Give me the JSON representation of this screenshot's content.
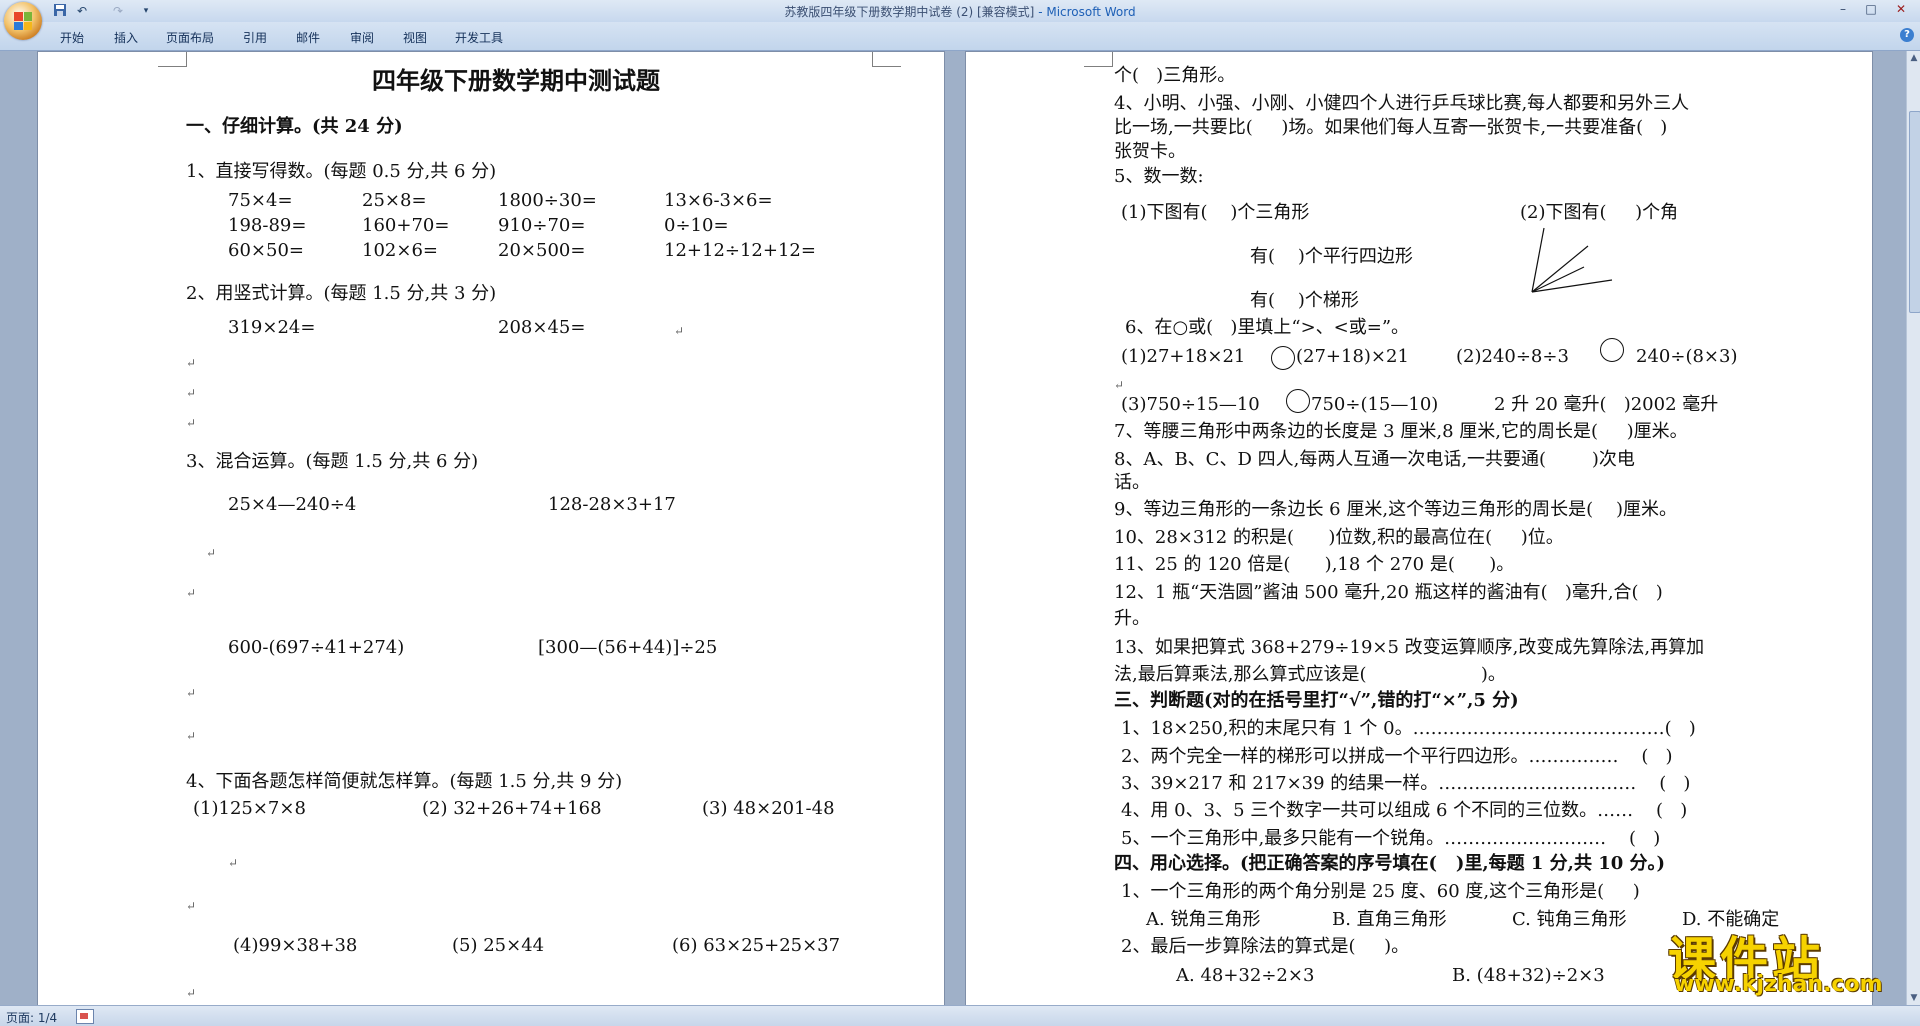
{
  "window": {
    "title": "苏教版四年级下册数学期中试卷 (2) [兼容模式]",
    "app": " - Microsoft Word",
    "minimize": "–",
    "maximize": "□",
    "close": "✕"
  },
  "quick_access": {
    "undo": "↶",
    "redo": "↷",
    "customize": "▾"
  },
  "ribbon_tabs": [
    "开始",
    "插入",
    "页面布局",
    "引用",
    "邮件",
    "审阅",
    "视图",
    "开发工具"
  ],
  "help": "?",
  "page1": {
    "title": "四年级下册数学期中测试题",
    "section1": "一、仔细计算。(共 24 分)",
    "q1": "1、直接写得数。(每题 0.5 分,共 6 分)",
    "q1_rows": [
      [
        "75×4=",
        "25×8=",
        "1800÷30=",
        "13×6-3×6="
      ],
      [
        "198-89=",
        "160+70=",
        "910÷70=",
        "0÷10="
      ],
      [
        "60×50=",
        "102×6=",
        "20×500=",
        "12+12÷12+12="
      ]
    ],
    "q2": "2、用竖式计算。(每题 1.5 分,共 3 分)",
    "q2_items": [
      "319×24=",
      "208×45="
    ],
    "q3": "3、混合运算。(每题 1.5 分,共 6 分)",
    "q3_items": [
      "25×4—240÷4",
      "128-28×3+17",
      "600-(697÷41+274)",
      "[300—(56+44)]÷25"
    ],
    "q4": "4、下面各题怎样简便就怎样算。(每题 1.5 分,共 9 分)",
    "q4_items": [
      "(1)125×7×8",
      "(2) 32+26+74+168",
      "(3) 48×201-48",
      "(4)99×38+38",
      "(5) 25×44",
      "(6) 63×25+25×37"
    ]
  },
  "page2": {
    "lines": [
      "个(   )三角形。",
      "4、小明、小强、小刚、小健四个人进行乒乓球比赛,每人都要和另外三人",
      "比一场,一共要比(     )场。如果他们每人互寄一张贺卡,一共要准备(   )",
      "张贺卡。",
      "5、数一数:",
      "(1)下图有(    )个三角形",
      "(2)下图有(     )个角",
      "有(    )个平行四边形",
      "有(    )个梯形",
      "6、在○或(   )里填上“>、<或=”。",
      "(1)27+18×21",
      "(27+18)×21",
      "(2)240÷8÷3",
      "240÷(8×3)",
      "(3)750÷15—10",
      "750÷(15—10)",
      "2 升 20 毫升(   )2002 毫升",
      "7、等腰三角形中两条边的长度是 3 厘米,8 厘米,它的周长是(     )厘米。",
      "8、A、B、C、D 四人,每两人互通一次电话,一共要通(        )次电",
      "话。",
      "9、等边三角形的一条边长 6 厘米,这个等边三角形的周长是(    )厘米。",
      "10、28×312 的积是(      )位数,积的最高位在(     )位。",
      "11、25 的 120 倍是(      ),18 个 270 是(      )。",
      "12、1 瓶“天浩圆”酱油 500 毫升,20 瓶这样的酱油有(   )毫升,合(   )",
      "升。",
      "13、如果把算式 368+279÷19×5 改变运算顺序,改变成先算除法,再算加",
      "法,最后算乘法,那么算式应该是(                    )。",
      "三、判断题(对的在括号里打“√”,错的打“×”,5 分)",
      "1、18×250,积的末尾只有 1 个 0。……………………………………(   )",
      "2、两个完全一样的梯形可以拼成一个平行四边形。……………    (   )",
      "3、39×217 和 217×39 的结果一样。……………………………    (   )",
      "4、用 0、3、5 三个数字一共可以组成 6 个不同的三位数。……    (   )",
      "5、一个三角形中,最多只能有一个锐角。………………………    (   )",
      "四、用心选择。(把正确答案的序号填在(   )里,每题 1 分,共 10 分。)",
      "1、一个三角形的两个角分别是 25 度、60 度,这个三角形是(     )",
      "A. 锐角三角形",
      "B. 直角三角形",
      "C. 钝角三角形",
      "D. 不能确定",
      "2、最后一步算除法的算式是(     )。",
      "A. 48+32÷2×3",
      "B. (48+32)÷2×3"
    ]
  },
  "status": {
    "page": "页面: 1/4"
  },
  "watermark": {
    "logo": "课件站",
    "url": "www.kjzhan.com"
  }
}
